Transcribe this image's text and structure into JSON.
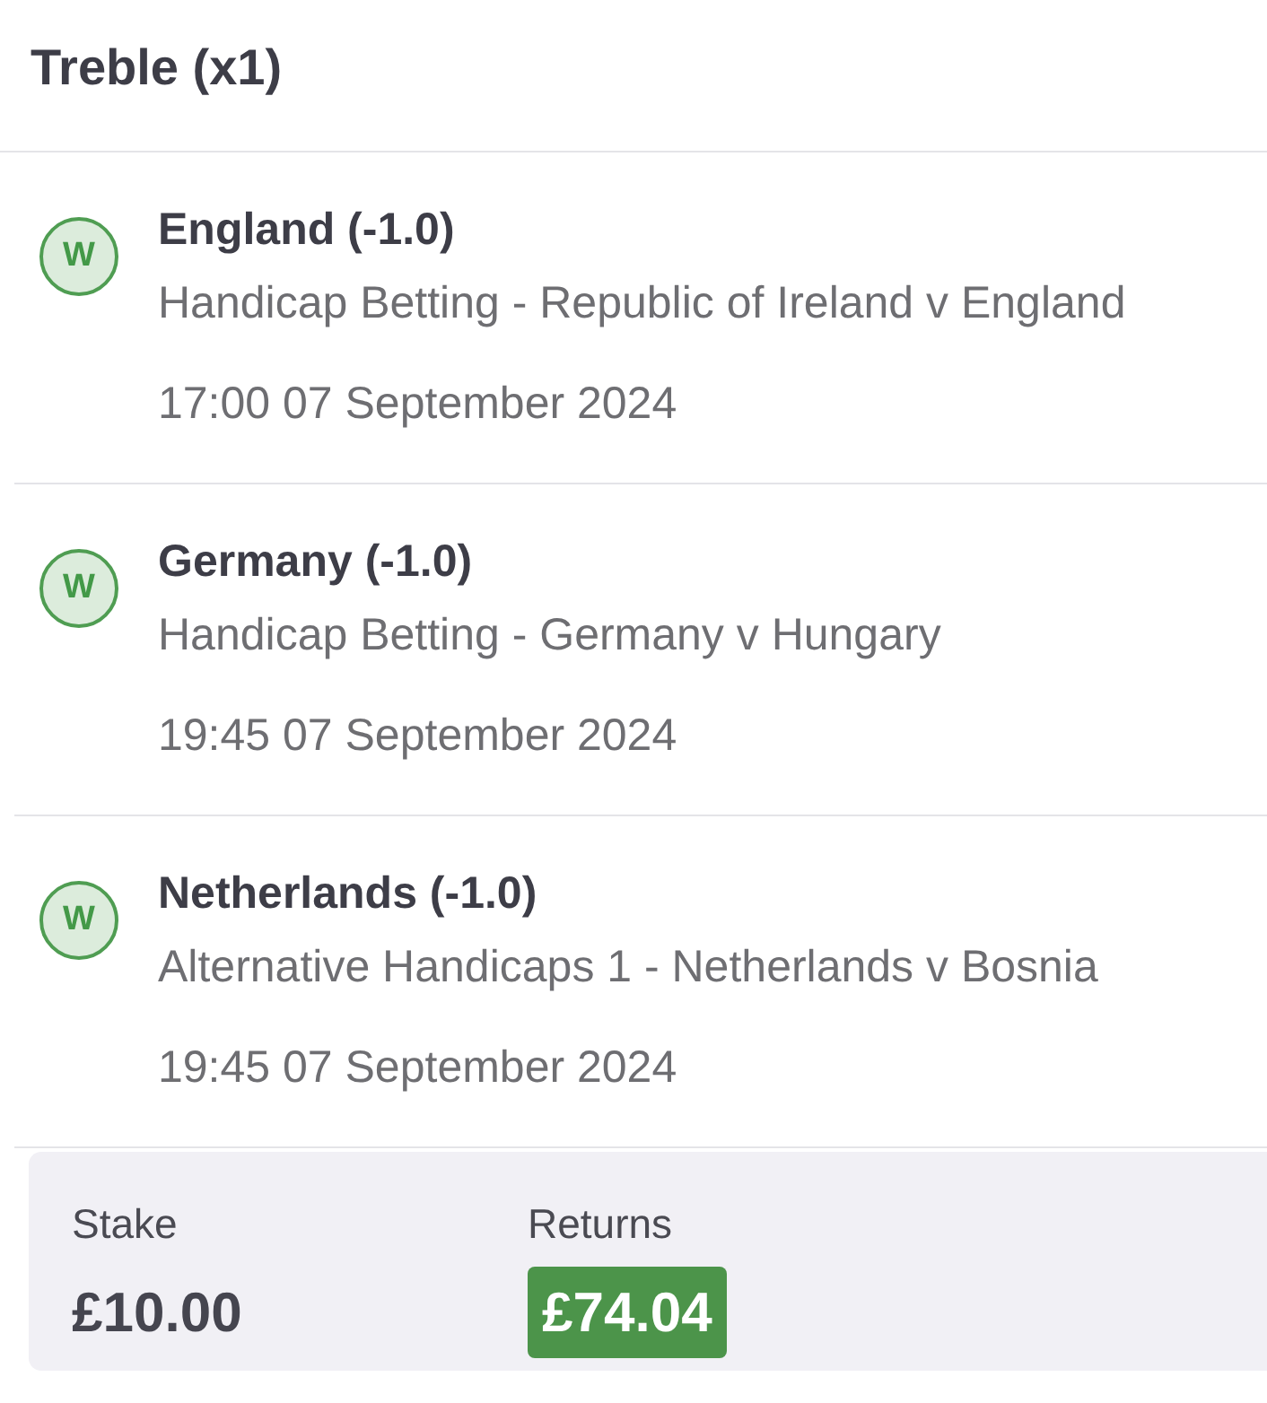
{
  "bet_title": "Treble (x1)",
  "legs": [
    {
      "result": "W",
      "selection": "England (-1.0)",
      "market": "Handicap Betting - Republic of Ireland v England",
      "start_time": "17:00 07 September 2024"
    },
    {
      "result": "W",
      "selection": "Germany (-1.0)",
      "market": "Handicap Betting - Germany v Hungary",
      "start_time": "19:45 07 September 2024"
    },
    {
      "result": "W",
      "selection": "Netherlands (-1.0)",
      "market": "Alternative Handicaps 1 - Netherlands v Bosnia",
      "start_time": "19:45 07 September 2024"
    }
  ],
  "summary": {
    "stake_label": "Stake",
    "stake": "£10.00",
    "returns_label": "Returns",
    "returns": "£74.04",
    "won": true
  }
}
